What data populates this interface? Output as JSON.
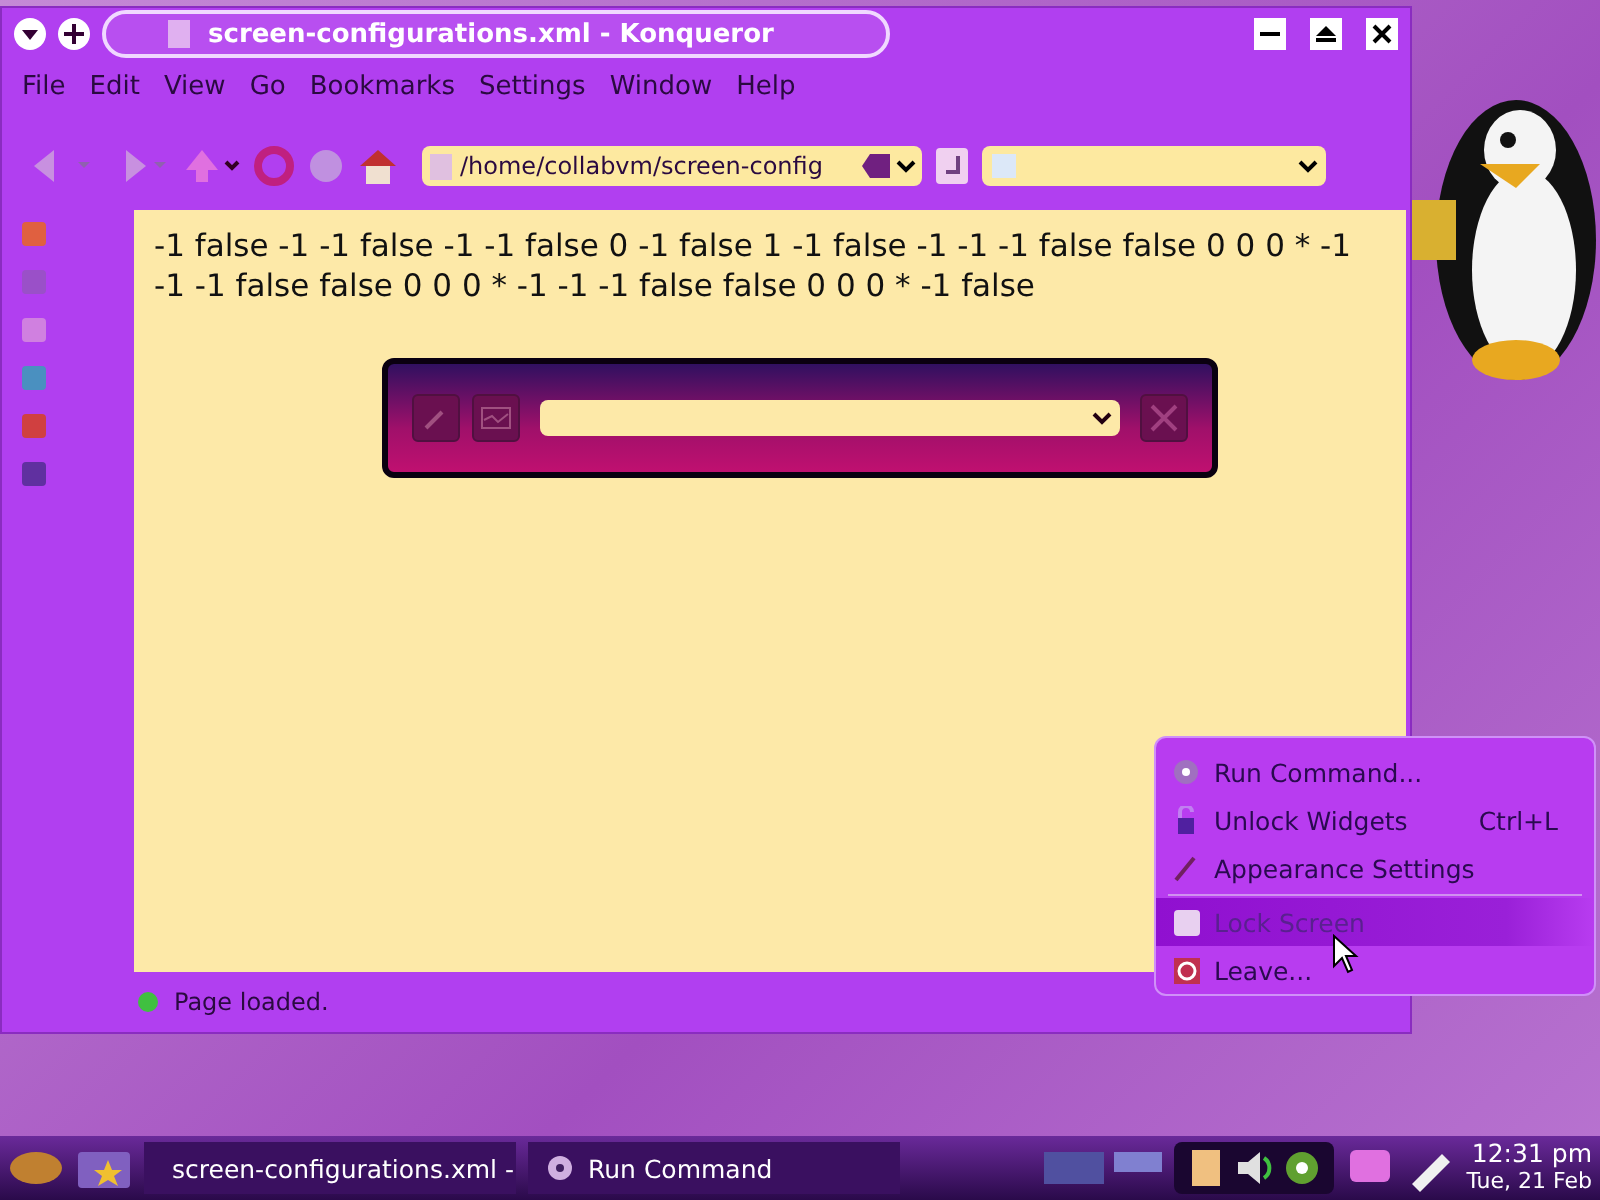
{
  "window": {
    "title": "screen-configurations.xml - Konqueror"
  },
  "menu_bar": [
    "File",
    "Edit",
    "View",
    "Go",
    "Bookmarks",
    "Settings",
    "Window",
    "Help"
  ],
  "toolbar": {
    "location": "/home/collabvm/screen-config"
  },
  "content": {
    "text": "-1 false -1 -1 false -1 -1 false 0 -1 false 1 -1 false -1 -1 -1 false false 0 0 0 * -1 -1 -1 false false 0 0 0 * -1 -1 -1 false false 0 0 0 * -1 false"
  },
  "status_bar": {
    "text": "Page loaded."
  },
  "context_menu": {
    "groups": [
      [
        {
          "label": "Run Command...",
          "selected": false
        },
        {
          "label": "Unlock Widgets",
          "shortcut": "Ctrl+L",
          "selected": false
        },
        {
          "label": "Appearance Settings",
          "selected": false
        }
      ],
      [
        {
          "label": "Lock Screen",
          "selected": true
        },
        {
          "label": "Leave...",
          "selected": false
        }
      ]
    ]
  },
  "taskbar": {
    "tasks": [
      {
        "label": "screen-configurations.xml -",
        "selected": false
      },
      {
        "label": "Run Command",
        "selected": false
      }
    ],
    "clock": {
      "time": "12:31 pm",
      "date": "Tue, 21 Feb"
    }
  }
}
